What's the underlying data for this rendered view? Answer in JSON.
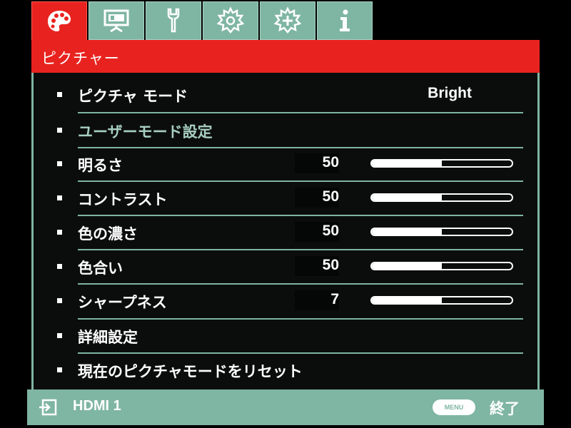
{
  "tabs": [
    {
      "icon": "palette-icon",
      "active": true
    },
    {
      "icon": "projector-screen-icon",
      "active": false
    },
    {
      "icon": "wrench-icon",
      "active": false
    },
    {
      "icon": "gear-icon",
      "active": false
    },
    {
      "icon": "advanced-gear-icon",
      "active": false
    },
    {
      "icon": "info-icon",
      "active": false
    }
  ],
  "header": {
    "title": "ピクチャー"
  },
  "menu": {
    "picture_mode": {
      "label": "ピクチャ モード",
      "value": "Bright"
    },
    "user_mode_settings": {
      "label": "ユーザーモード設定",
      "disabled": true
    },
    "brightness": {
      "label": "明るさ",
      "value": "50",
      "level": 0.5
    },
    "contrast": {
      "label": "コントラスト",
      "value": "50",
      "level": 0.5
    },
    "color": {
      "label": "色の濃さ",
      "value": "50",
      "level": 0.5
    },
    "tint": {
      "label": "色合い",
      "value": "50",
      "level": 0.5
    },
    "sharpness": {
      "label": "シャープネス",
      "value": "7",
      "level": 0.5
    },
    "advanced": {
      "label": "詳細設定"
    },
    "reset": {
      "label": "現在のピクチャモードをリセット"
    }
  },
  "footer": {
    "source_icon": "input-source-icon",
    "source": "HDMI 1",
    "menu_key_label": "MENU",
    "exit_label": "終了"
  },
  "colors": {
    "accent_red": "#e8231f",
    "teal": "#7fb5a3",
    "background": "#0b0d0c",
    "text": "#ffffff"
  }
}
